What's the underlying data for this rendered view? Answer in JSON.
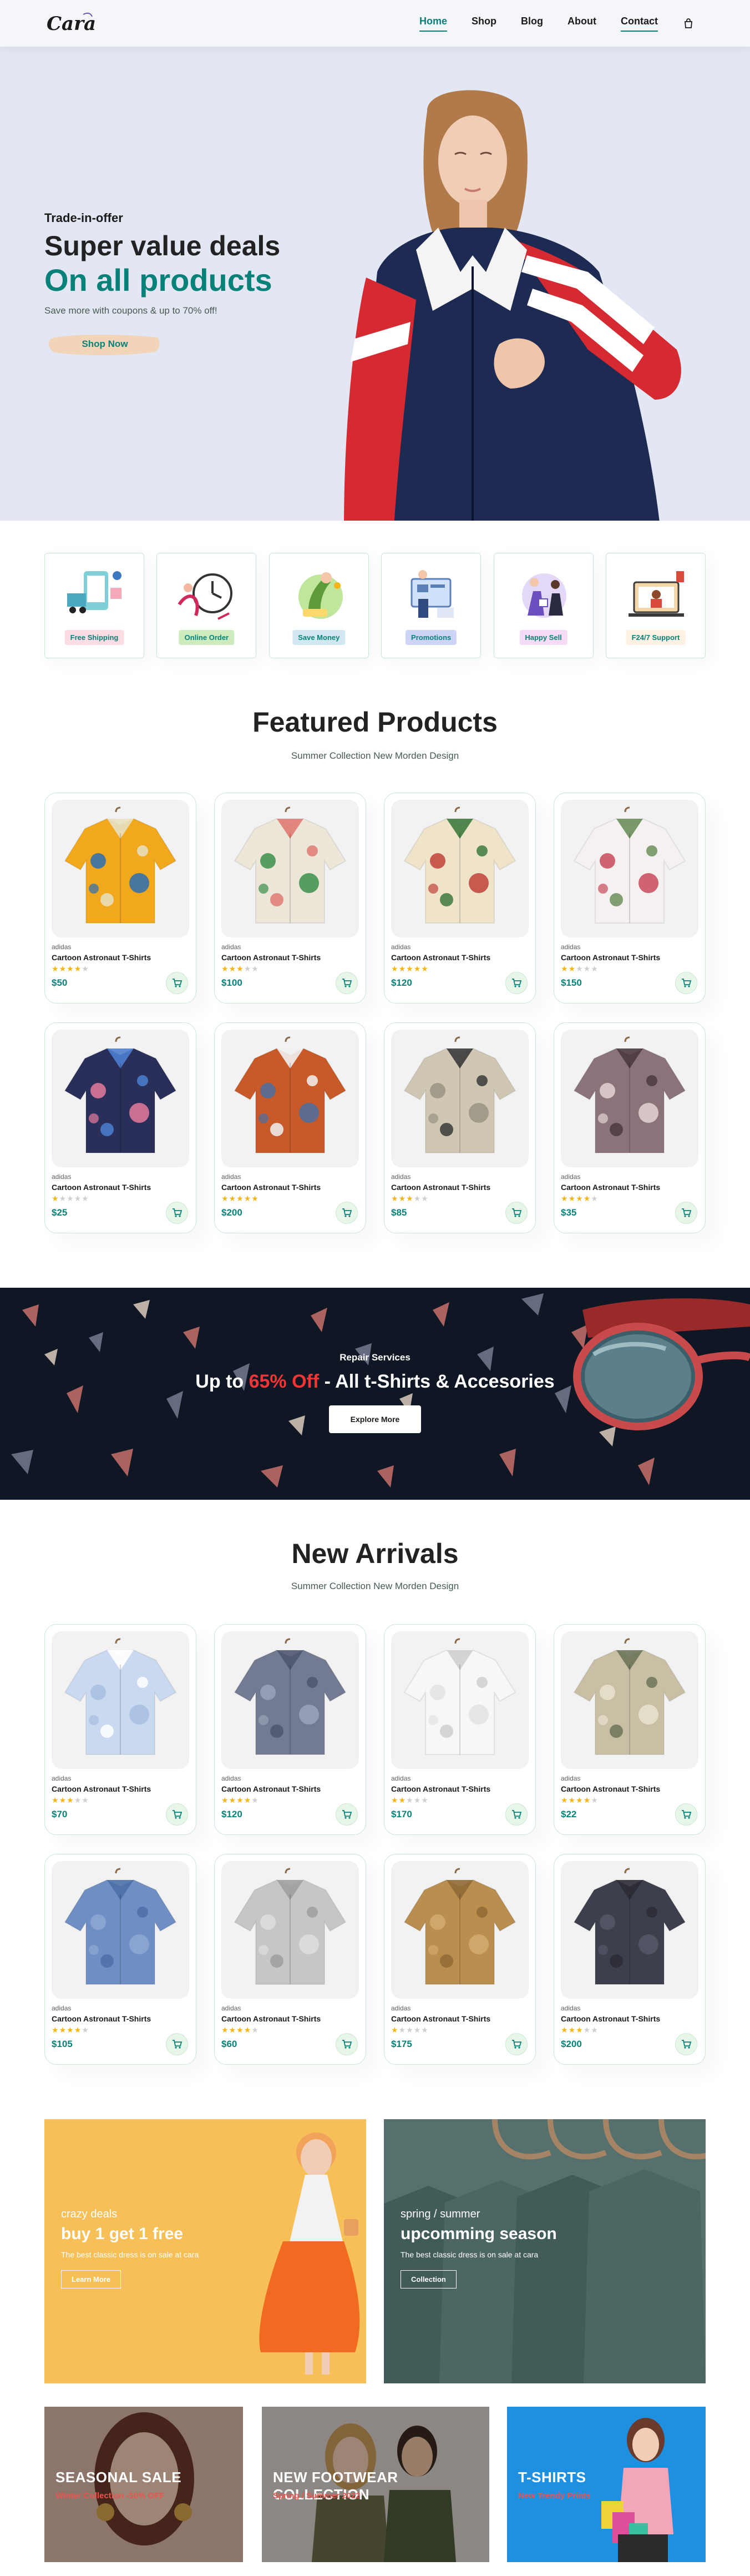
{
  "brand": {
    "logo_text": "Cara"
  },
  "nav": {
    "items": [
      {
        "label": "Home",
        "active": true
      },
      {
        "label": "Shop",
        "active": false
      },
      {
        "label": "Blog",
        "active": false
      },
      {
        "label": "About",
        "active": false
      },
      {
        "label": "Contact",
        "active": false
      }
    ]
  },
  "hero": {
    "kicker": "Trade-in-offer",
    "line1": "Super value deals",
    "line2": "On all products",
    "subtitle": "Save more with coupons & up to 70% off!",
    "cta": "Shop Now"
  },
  "features": [
    {
      "label": "Free Shipping",
      "bg": "#fddde4",
      "icon": "delivery-icon"
    },
    {
      "label": "Online Order",
      "bg": "#cdebbc",
      "icon": "clock-order-icon"
    },
    {
      "label": "Save Money",
      "bg": "#d1e8f2",
      "icon": "money-icon"
    },
    {
      "label": "Promotions",
      "bg": "#cdd4f8",
      "icon": "promotion-icon"
    },
    {
      "label": "Happy Sell",
      "bg": "#f6dbf6",
      "icon": "happy-sell-icon"
    },
    {
      "label": "F24/7 Support",
      "bg": "#fff2e5",
      "icon": "support-icon"
    }
  ],
  "featured": {
    "title": "Featured Products",
    "subtitle": "Summer Collection New Morden Design",
    "products": [
      {
        "brand": "adidas",
        "name": "Cartoon Astronaut T-Shirts",
        "rating": 4,
        "price": "$50",
        "c1": "#f2a81d",
        "c2": "#2b6fb3",
        "c3": "#e8e0c2"
      },
      {
        "brand": "adidas",
        "name": "Cartoon Astronaut T-Shirts",
        "rating": 3,
        "price": "$100",
        "c1": "#ece7d8",
        "c2": "#3c8f4b",
        "c3": "#e07a73"
      },
      {
        "brand": "adidas",
        "name": "Cartoon Astronaut T-Shirts",
        "rating": 5,
        "price": "$120",
        "c1": "#efe3c9",
        "c2": "#c0413a",
        "c3": "#3e7a3e"
      },
      {
        "brand": "adidas",
        "name": "Cartoon Astronaut T-Shirts",
        "rating": 2,
        "price": "$150",
        "c1": "#f6f1f1",
        "c2": "#c84a5c",
        "c3": "#6b8f5c"
      },
      {
        "brand": "adidas",
        "name": "Cartoon Astronaut T-Shirts",
        "rating": 1,
        "price": "$25",
        "c1": "#2a2f5a",
        "c2": "#e57a9c",
        "c3": "#4b7fd0"
      },
      {
        "brand": "adidas",
        "name": "Cartoon Astronaut T-Shirts",
        "rating": 5,
        "price": "$200",
        "c1": "#c85a2a",
        "c2": "#4a6fa0",
        "c3": "#f1f1f1"
      },
      {
        "brand": "adidas",
        "name": "Cartoon Astronaut T-Shirts",
        "rating": 3,
        "price": "$85",
        "c1": "#cfc7b4",
        "c2": "#9a9381",
        "c3": "#3a3a3a"
      },
      {
        "brand": "adidas",
        "name": "Cartoon Astronaut T-Shirts",
        "rating": 4,
        "price": "$35",
        "c1": "#8b737a",
        "c2": "#e4d4d4",
        "c3": "#4b3a40"
      }
    ]
  },
  "banner": {
    "kicker": "Repair Services",
    "head_prefix": "Up to",
    "head_highlight": "65% Off",
    "head_suffix": "- All t-Shirts & Accesories",
    "button": "Explore More"
  },
  "arrivals": {
    "title": "New Arrivals",
    "subtitle": "Summer Collection New Morden Design",
    "products": [
      {
        "brand": "adidas",
        "name": "Cartoon Astronaut T-Shirts",
        "rating": 3,
        "price": "$70",
        "c1": "#c9d9ef",
        "c2": "#a7bee0",
        "c3": "#ffffff"
      },
      {
        "brand": "adidas",
        "name": "Cartoon Astronaut T-Shirts",
        "rating": 4,
        "price": "$120",
        "c1": "#727b92",
        "c2": "#9aa3b8",
        "c3": "#4f5670"
      },
      {
        "brand": "adidas",
        "name": "Cartoon Astronaut T-Shirts",
        "rating": 2,
        "price": "$170",
        "c1": "#f7f7f7",
        "c2": "#e3e3e3",
        "c3": "#cfcfcf"
      },
      {
        "brand": "adidas",
        "name": "Cartoon Astronaut T-Shirts",
        "rating": 4,
        "price": "$22",
        "c1": "#c9bfa4",
        "c2": "#e9e2cf",
        "c3": "#6c7458"
      },
      {
        "brand": "adidas",
        "name": "Cartoon Astronaut T-Shirts",
        "rating": 4,
        "price": "$105",
        "c1": "#6f8fc4",
        "c2": "#8ea8d3",
        "c3": "#4d6fa8"
      },
      {
        "brand": "adidas",
        "name": "Cartoon Astronaut T-Shirts",
        "rating": 4,
        "price": "$60",
        "c1": "#c6c6c6",
        "c2": "#dedede",
        "c3": "#9e9e9e"
      },
      {
        "brand": "adidas",
        "name": "Cartoon Astronaut T-Shirts",
        "rating": 1,
        "price": "$175",
        "c1": "#b98e4f",
        "c2": "#d3ab6e",
        "c3": "#8f6a35"
      },
      {
        "brand": "adidas",
        "name": "Cartoon Astronaut T-Shirts",
        "rating": 3,
        "price": "$200",
        "c1": "#3e3f4c",
        "c2": "#565868",
        "c3": "#2a2b35"
      }
    ]
  },
  "promos": [
    {
      "kicker": "crazy deals",
      "title": "buy 1 get 1 free",
      "desc": "The best classic dress is on sale at cara",
      "button": "Learn More"
    },
    {
      "kicker": "spring / summer",
      "title": "upcomming season",
      "desc": "The best classic dress is on sale at cara",
      "button": "Collection"
    }
  ],
  "small_banners": [
    {
      "title": "SEASONAL SALE",
      "sub": "Winter Collection -50% OFF"
    },
    {
      "title": "NEW FOOTWEAR COLLECTION",
      "sub": "Spring / Summer 2022"
    },
    {
      "title": "T-SHIRTS",
      "sub": "New Trendy Prints"
    }
  ],
  "colors": {
    "accent": "#088178",
    "hero_bg": "#e3e6f3",
    "banner_bg": "#0f1624",
    "star": "#f3b519",
    "sale_red": "#ef3636"
  }
}
